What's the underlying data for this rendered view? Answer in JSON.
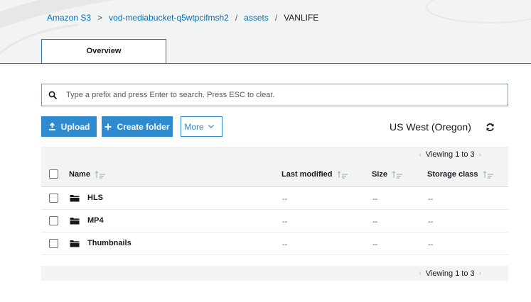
{
  "breadcrumb": {
    "items": [
      {
        "label": "Amazon S3"
      },
      {
        "label": "vod-mediabucket-q5wtpcifmsh2"
      },
      {
        "label": "assets"
      },
      {
        "label": "VANLIFE"
      }
    ],
    "separators": [
      ">",
      "/",
      "/"
    ]
  },
  "tabs": [
    {
      "label": "Overview",
      "active": true
    }
  ],
  "search": {
    "placeholder": "Type a prefix and press Enter to search. Press ESC to clear.",
    "value": "",
    "icon": "search-icon"
  },
  "toolbar": {
    "upload_label": "Upload",
    "create_folder_label": "Create folder",
    "more_label": "More",
    "region": "US West (Oregon)"
  },
  "pagination": {
    "top": "Viewing 1 to 3",
    "bottom": "Viewing 1 to 3"
  },
  "table": {
    "columns": [
      "Name",
      "Last modified",
      "Size",
      "Storage class"
    ],
    "rows": [
      {
        "name": "HLS",
        "last_modified": "--",
        "size": "--",
        "storage_class": "--",
        "icon": "folder-icon"
      },
      {
        "name": "MP4",
        "last_modified": "--",
        "size": "--",
        "storage_class": "--",
        "icon": "folder-icon"
      },
      {
        "name": "Thumbnails",
        "last_modified": "--",
        "size": "--",
        "storage_class": "--",
        "icon": "folder-icon"
      }
    ]
  },
  "colors": {
    "accent": "#2e8bd0",
    "link": "#0073bb",
    "header_bg": "#f2f3f3",
    "text": "#16191f"
  }
}
